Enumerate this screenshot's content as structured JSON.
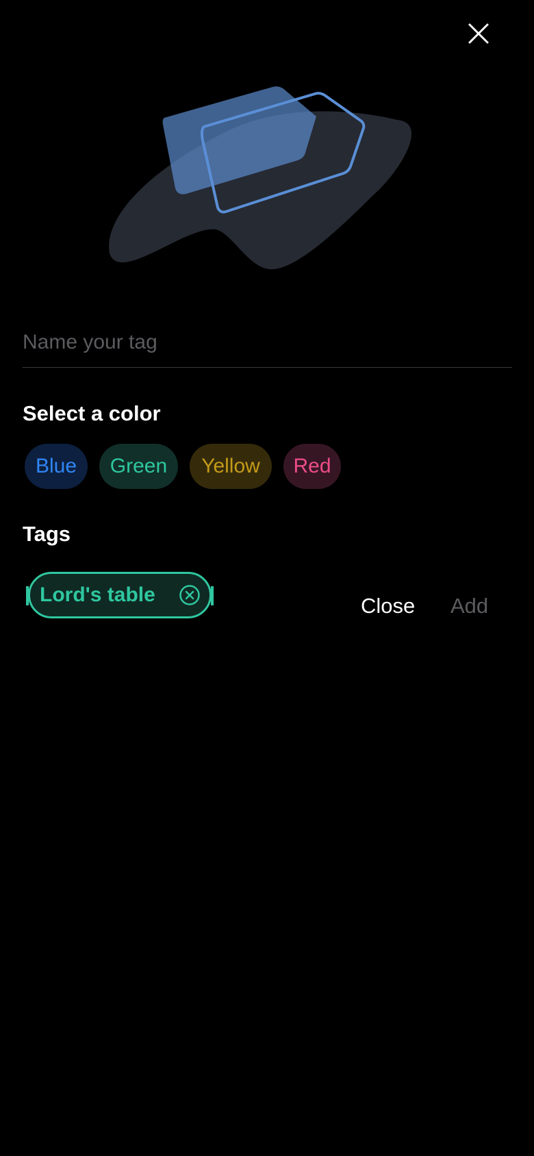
{
  "header": {
    "dismiss_icon": "close-icon"
  },
  "illustration": {
    "icon": "tag-cards-illustration",
    "colors": {
      "blob": "#262a33",
      "card_fill": "#5b8ccd",
      "card_outline": "#5a8fd6"
    }
  },
  "name_input": {
    "value": "",
    "placeholder": "Name your tag"
  },
  "color_section": {
    "title": "Select a color",
    "options": [
      {
        "label": "Blue",
        "color": "#2f86f5"
      },
      {
        "label": "Green",
        "color": "#2fc7a0"
      },
      {
        "label": "Yellow",
        "color": "#c49a18"
      },
      {
        "label": "Red",
        "color": "#ec4d86"
      }
    ]
  },
  "tags_section": {
    "title": "Tags",
    "tags": [
      {
        "label": "Lord's table",
        "color": "#2fc7a0",
        "remove_icon": "remove-circle-icon"
      }
    ]
  },
  "actions": {
    "close_label": "Close",
    "add_label": "Add"
  }
}
